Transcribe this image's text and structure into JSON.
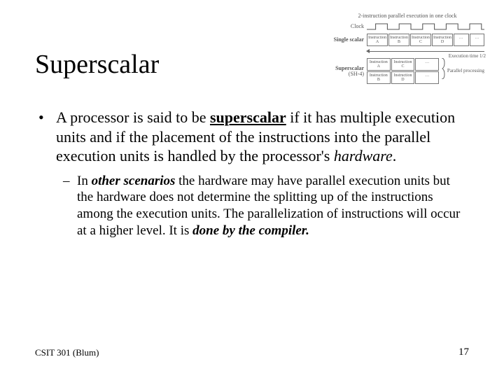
{
  "title": "Superscalar",
  "bullet1": {
    "pre": "A processor is said to be ",
    "term": "superscalar",
    "post1": " if it has multiple execution units and if the placement of the instructions into the parallel execution units is handled by the processor's ",
    "hw": "hardware",
    "post2": "."
  },
  "bullet2": {
    "pre": "In ",
    "other": "other scenarios",
    "mid": " the hardware may have parallel execution units but the hardware does not determine the splitting up of the instructions among the execution units.  The parallelization of instructions will occur at a higher level.  It is ",
    "done": "done by the compiler.",
    "post": ""
  },
  "footer_left": "CSIT 301 (Blum)",
  "footer_right": "17",
  "diagram": {
    "title": "2-instruction parallel execution in one clock",
    "clock_label": "Clock",
    "single_label": "Single scalar",
    "super_label_1": "Superscalar",
    "super_label_2": "(SH-4)",
    "instr_a": "Instruction A",
    "instr_b": "Instruction B",
    "instr_c": "Instruction C",
    "instr_d": "Instruction D",
    "dots": "…",
    "exec_time": "Execution time 1/2",
    "parallel": "Parallel processing"
  }
}
